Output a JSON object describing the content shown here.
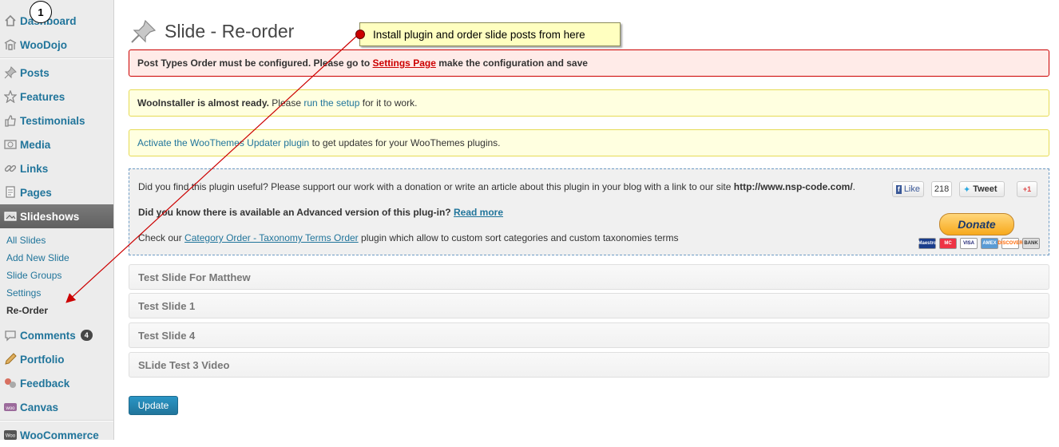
{
  "sidebar": {
    "items": [
      {
        "label": "Dashboard",
        "icon": "house-icon"
      },
      {
        "label": "WooDojo",
        "icon": "woodojo-icon"
      },
      {
        "label": "Posts",
        "icon": "pushpin-icon"
      },
      {
        "label": "Features",
        "icon": "star-icon"
      },
      {
        "label": "Testimonials",
        "icon": "thumbs-up-icon"
      },
      {
        "label": "Media",
        "icon": "media-icon"
      },
      {
        "label": "Links",
        "icon": "link-icon"
      },
      {
        "label": "Pages",
        "icon": "pages-icon"
      },
      {
        "label": "Slideshows",
        "icon": "slideshow-icon"
      },
      {
        "label": "Comments",
        "icon": "comment-bubble-icon",
        "count": "4"
      },
      {
        "label": "Portfolio",
        "icon": "pencil-icon"
      },
      {
        "label": "Feedback",
        "icon": "feedback-icon"
      },
      {
        "label": "Canvas",
        "icon": "woo-icon"
      },
      {
        "label": "WooCommerce",
        "icon": "woocommerce-icon"
      }
    ],
    "submenu": [
      "All Slides",
      "Add New Slide",
      "Slide Groups",
      "Settings",
      "Re-Order"
    ]
  },
  "page": {
    "title": "Slide - Re-order"
  },
  "notices": {
    "error": {
      "before": "Post Types Order must be configured. Please go to",
      "link": "Settings Page",
      "after": "make the configuration and save"
    },
    "installer": {
      "bold": "WooInstaller is almost ready.",
      "before": "Please",
      "link": "run the setup",
      "after": "for it to work."
    },
    "updater": {
      "link": "Activate the WooThemes Updater plugin",
      "after": "to get updates for your WooThemes plugins."
    }
  },
  "promo": {
    "line1_text": "Did you find this plugin useful? Please support our work with a donation or write an article about this plugin in your blog with a link to our site",
    "line1_url": "http://www.nsp-code.com/",
    "line1_end": ".",
    "line2_bold": "Did you know there is available an Advanced version of this plug-in?",
    "line2_link": "Read more",
    "line3_before": "Check our",
    "line3_link": "Category Order - Taxonomy Terms Order",
    "line3_after": "plugin which allow to custom sort categories and custom taxonomies terms",
    "social": {
      "like": "Like",
      "like_count": "218",
      "tweet": "Tweet",
      "gplus": "+1"
    },
    "donate": "Donate",
    "cards": [
      "Maestro",
      "MC",
      "VISA",
      "AMEX",
      "DISCOVER",
      "BANK"
    ]
  },
  "slides": [
    "Test Slide For Matthew",
    "Test Slide 1",
    "Test Slide 4",
    "SLide Test 3 Video"
  ],
  "update_button": "Update",
  "annotation": {
    "callout": "Install plugin and order slide posts from here",
    "step": "1"
  },
  "colors": {
    "accent": "#21759b",
    "error_border": "#cc0000",
    "notice_bg": "#ffffe0",
    "arrow": "#cc0000"
  }
}
